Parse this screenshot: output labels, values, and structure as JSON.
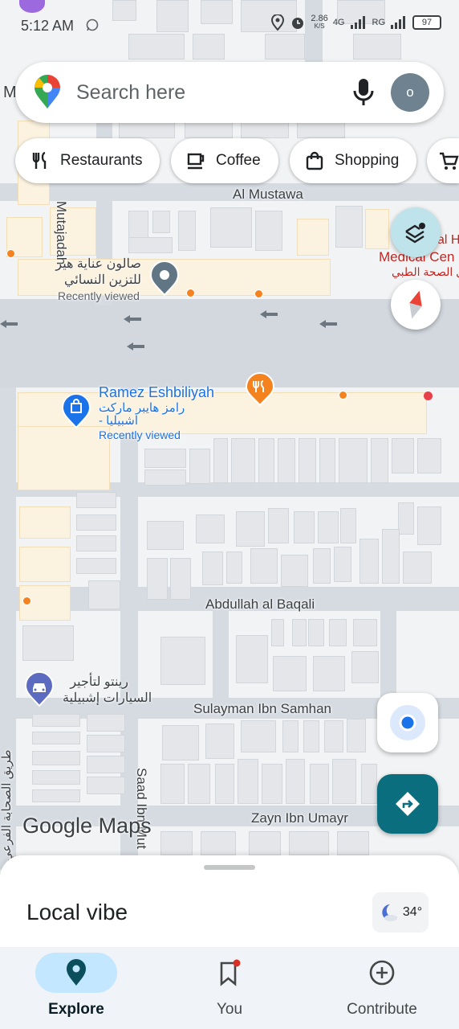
{
  "status_bar": {
    "time": "5:12 AM",
    "speed": "2.86",
    "speed_unit": "K/S",
    "network_a": "4G",
    "network_b": "RG",
    "battery": "97"
  },
  "search": {
    "placeholder": "Search here",
    "avatar_initial": "o"
  },
  "chips": [
    {
      "label": "Restaurants",
      "icon": "fork-knife-icon"
    },
    {
      "label": "Coffee",
      "icon": "coffee-cup-icon"
    },
    {
      "label": "Shopping",
      "icon": "shopping-bag-icon"
    },
    {
      "label": "",
      "icon": "cart-icon"
    }
  ],
  "map": {
    "roads": [
      "Al Mustawa",
      "Abdullah al Baqali",
      "Sulayman Ibn Samhan",
      "Zayn Ibn Umayr",
      "Mutajadah",
      "Saad Ibn Mut",
      "طريق الصحابة الفرعي"
    ],
    "places": [
      {
        "name": "صالون عناية هير",
        "name2": "للتزين النسائي",
        "note": "Recently viewed"
      },
      {
        "name": "Ramez Eshbiliyah",
        "name2": "رامز هايبر ماركت",
        "name3": "- اشبيليا",
        "note": "Recently viewed"
      },
      {
        "name": "رينتو لتأجير",
        "name2": "السيارات إشبيلية"
      },
      {
        "name": "al H",
        "name2": "Medical Cen",
        "name3": "ال الصحة الطبي"
      }
    ],
    "edge_letter": "M",
    "logo": "Google Maps"
  },
  "sheet": {
    "title": "Local vibe",
    "temperature": "34°"
  },
  "nav": [
    {
      "label": "Explore",
      "active": true
    },
    {
      "label": "You",
      "active": false
    },
    {
      "label": "Contribute",
      "active": false
    }
  ],
  "colors": {
    "accent": "#0b6e7f",
    "active_pill": "#c2e7ff",
    "orange_poi": "#f4821f",
    "blue_pin": "#1a73e8"
  }
}
